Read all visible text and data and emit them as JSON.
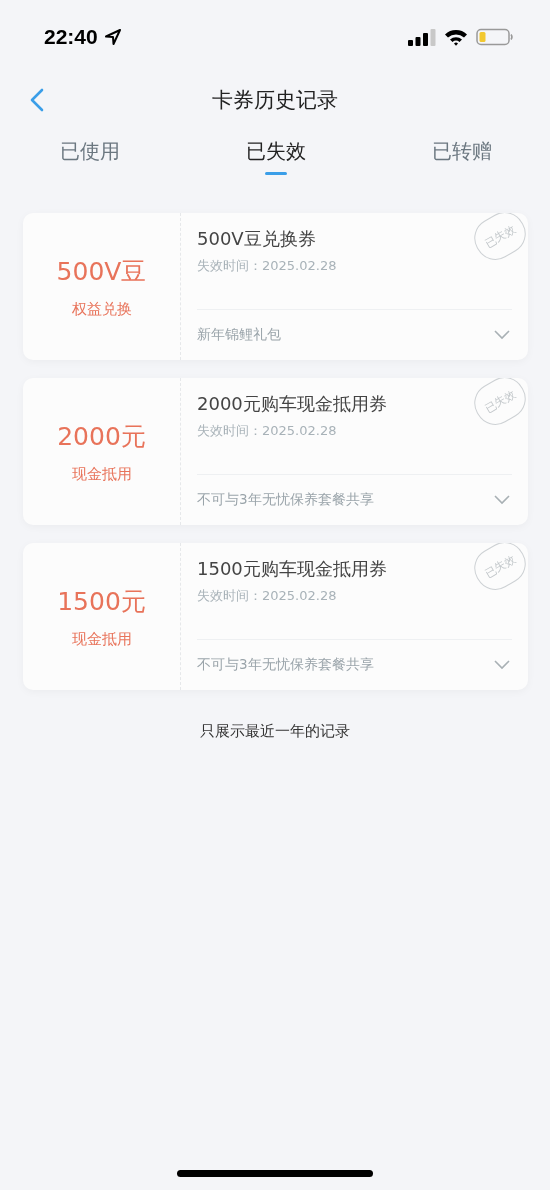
{
  "status_bar": {
    "time": "22:40"
  },
  "nav": {
    "title": "卡券历史记录"
  },
  "tabs": [
    {
      "label": "已使用",
      "selected": false
    },
    {
      "label": "已失效",
      "selected": true
    },
    {
      "label": "已转赠",
      "selected": false
    }
  ],
  "coupons": [
    {
      "amount": "500V豆",
      "type": "权益兑换",
      "name": "500V豆兑换券",
      "expiry": "失效时间：2025.02.28",
      "note": "新年锦鲤礼包",
      "stamp": "已失效",
      "expanded": false
    },
    {
      "amount": "2000元",
      "type": "现金抵用",
      "name": "2000元购车现金抵用券",
      "expiry": "失效时间：2025.02.28",
      "note": "不可与3年无忧保养套餐共享",
      "stamp": "已失效",
      "expanded": false
    },
    {
      "amount": "1500元",
      "type": "现金抵用",
      "name": "1500元购车现金抵用券",
      "expiry": "失效时间：2025.02.28",
      "note": "不可与3年无忧保养套餐共享",
      "stamp": "已失效",
      "expanded": false
    }
  ],
  "footer_note": "只展示最近一年的记录"
}
